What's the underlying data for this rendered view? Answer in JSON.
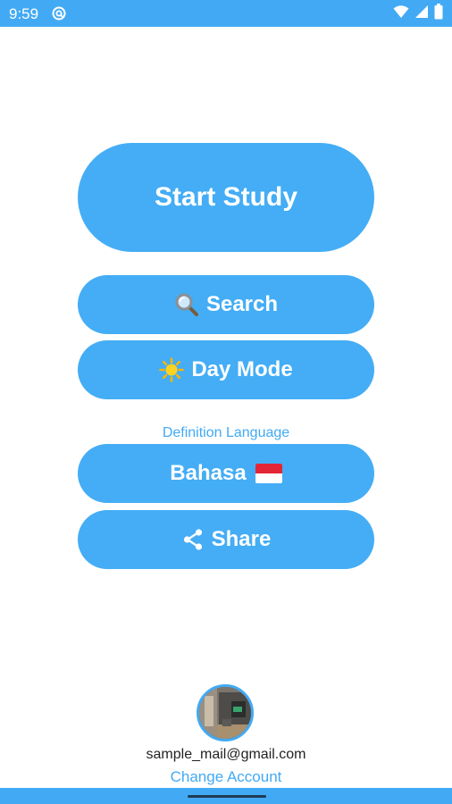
{
  "status_bar": {
    "time": "9:59",
    "app_icon": "at-sign-icon",
    "icons": [
      "wifi-icon",
      "signal-icon",
      "battery-icon"
    ]
  },
  "menu": {
    "start_study": "Start Study",
    "search": "Search",
    "search_icon": "magnifier-icon",
    "day_mode": "Day Mode",
    "day_mode_icon": "sun-icon",
    "definition_language_label": "Definition Language",
    "language": "Bahasa",
    "language_flag": "indonesia-flag-icon",
    "share": "Share",
    "share_icon": "share-icon"
  },
  "account": {
    "email": "sample_mail@gmail.com",
    "change_account": "Change Account"
  },
  "colors": {
    "accent": "#42aaf4",
    "button": "#44adf5",
    "text": "#222222"
  }
}
